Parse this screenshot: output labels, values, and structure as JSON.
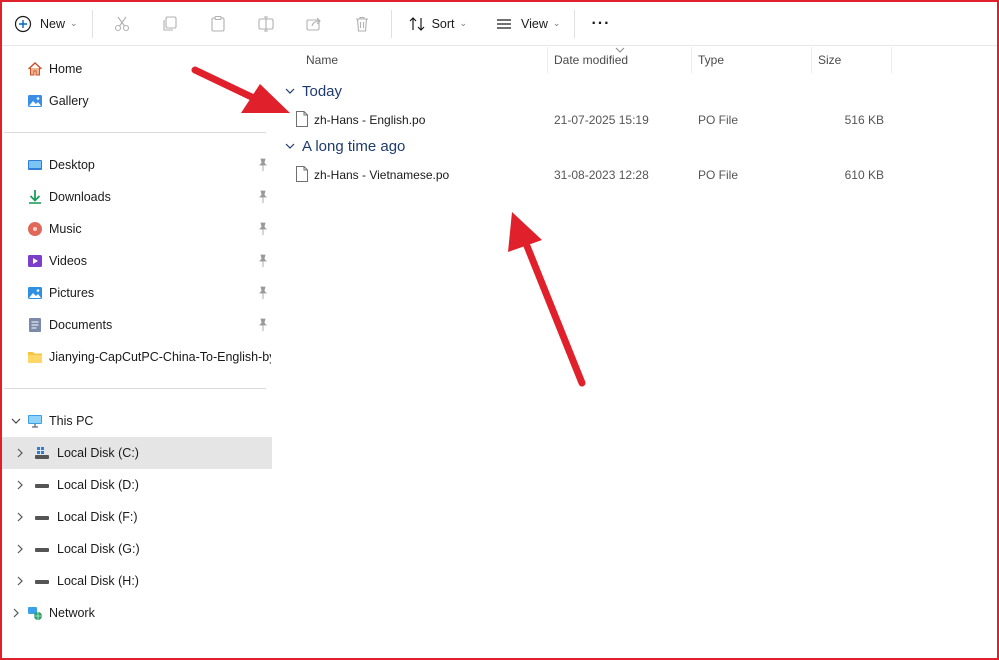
{
  "toolbar": {
    "new_label": "New",
    "sort_label": "Sort",
    "view_label": "View",
    "more_label": "···",
    "icons": [
      "cut-icon",
      "copy-icon",
      "paste-icon",
      "rename-icon",
      "share-icon",
      "delete-icon"
    ]
  },
  "sidebar": {
    "quick": [
      {
        "label": "Home",
        "icon": "home-icon"
      },
      {
        "label": "Gallery",
        "icon": "gallery-icon"
      }
    ],
    "pinned": [
      {
        "label": "Desktop",
        "icon": "desktop-icon",
        "pinned": true
      },
      {
        "label": "Downloads",
        "icon": "downloads-icon",
        "pinned": true
      },
      {
        "label": "Music",
        "icon": "music-icon",
        "pinned": true
      },
      {
        "label": "Videos",
        "icon": "videos-icon",
        "pinned": true
      },
      {
        "label": "Pictures",
        "icon": "pictures-icon",
        "pinned": true
      },
      {
        "label": "Documents",
        "icon": "documents-icon",
        "pinned": true
      },
      {
        "label": "Jianying-CapCutPC-China-To-English-by-",
        "icon": "folder-icon",
        "pinned": false
      }
    ],
    "this_pc": "This PC",
    "drives": [
      {
        "label": "Local Disk (C:)",
        "selected": true
      },
      {
        "label": "Local Disk (D:)",
        "selected": false
      },
      {
        "label": "Local Disk (F:)",
        "selected": false
      },
      {
        "label": "Local Disk (G:)",
        "selected": false
      },
      {
        "label": "Local Disk (H:)",
        "selected": false
      }
    ],
    "network": "Network"
  },
  "columns": {
    "name": "Name",
    "date": "Date modified",
    "type": "Type",
    "size": "Size"
  },
  "groups": [
    {
      "title": "Today",
      "files": [
        {
          "name": "zh-Hans - English.po",
          "date": "21-07-2025 15:19",
          "type": "PO File",
          "size": "516 KB"
        }
      ]
    },
    {
      "title": "A long time ago",
      "files": [
        {
          "name": "zh-Hans - Vietnamese.po",
          "date": "31-08-2023 12:28",
          "type": "PO File",
          "size": "610 KB"
        }
      ]
    }
  ],
  "colors": {
    "accent": "#0067c0",
    "group_title": "#1f3c6e",
    "annotation_red": "#e0202a",
    "selected_bg": "#e5e5e5"
  }
}
